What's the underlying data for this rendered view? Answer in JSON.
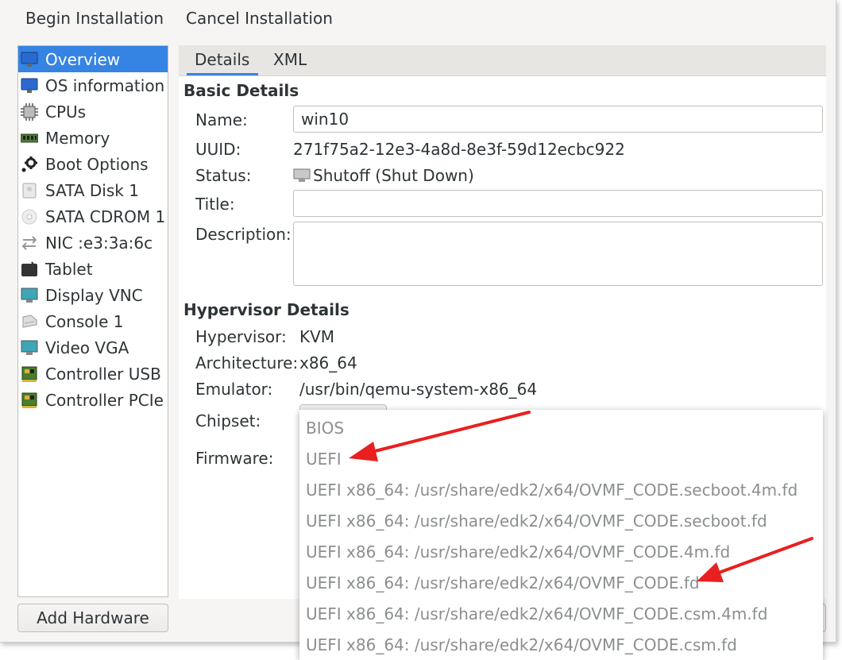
{
  "toolbar": {
    "begin_label": "Begin Installation",
    "cancel_label": "Cancel Installation"
  },
  "sidebar": {
    "items": [
      {
        "label": "Overview",
        "icon": "monitor-icon",
        "selected": true
      },
      {
        "label": "OS information",
        "icon": "monitor-icon"
      },
      {
        "label": "CPUs",
        "icon": "cpu-icon"
      },
      {
        "label": "Memory",
        "icon": "memory-icon"
      },
      {
        "label": "Boot Options",
        "icon": "gear-icon"
      },
      {
        "label": "SATA Disk 1",
        "icon": "disk-icon"
      },
      {
        "label": "SATA CDROM 1",
        "icon": "cdrom-icon"
      },
      {
        "label": "NIC :e3:3a:6c",
        "icon": "network-icon"
      },
      {
        "label": "Tablet",
        "icon": "tablet-icon"
      },
      {
        "label": "Display VNC",
        "icon": "display-icon"
      },
      {
        "label": "Console 1",
        "icon": "console-icon"
      },
      {
        "label": "Video VGA",
        "icon": "display-icon"
      },
      {
        "label": "Controller USB",
        "icon": "controller-icon"
      },
      {
        "label": "Controller PCIe",
        "icon": "controller-icon"
      }
    ],
    "add_hardware_label": "Add Hardware"
  },
  "tabs": [
    {
      "label": "Details",
      "active": true
    },
    {
      "label": "XML"
    }
  ],
  "basic": {
    "title": "Basic Details",
    "name_label": "Name:",
    "name_value": "win10",
    "uuid_label": "UUID:",
    "uuid_value": "271f75a2-12e3-4a8d-8e3f-59d12ecbc922",
    "status_label": "Status:",
    "status_value": "Shutoff (Shut Down)",
    "title_label": "Title:",
    "title_value": "",
    "description_label": "Description:",
    "description_value": ""
  },
  "hypervisor": {
    "title": "Hypervisor Details",
    "hypervisor_label": "Hypervisor:",
    "hypervisor_value": "KVM",
    "arch_label": "Architecture:",
    "arch_value": "x86_64",
    "emulator_label": "Emulator:",
    "emulator_value": "/usr/bin/qemu-system-x86_64",
    "chipset_label": "Chipset:",
    "firmware_label": "Firmware:"
  },
  "firmware_dropdown": {
    "options": [
      "BIOS",
      "UEFI",
      "UEFI x86_64: /usr/share/edk2/x64/OVMF_CODE.secboot.4m.fd",
      "UEFI x86_64: /usr/share/edk2/x64/OVMF_CODE.secboot.fd",
      "UEFI x86_64: /usr/share/edk2/x64/OVMF_CODE.4m.fd",
      "UEFI x86_64: /usr/share/edk2/x64/OVMF_CODE.fd",
      "UEFI x86_64: /usr/share/edk2/x64/OVMF_CODE.csm.4m.fd",
      "UEFI x86_64: /usr/share/edk2/x64/OVMF_CODE.csm.fd"
    ]
  },
  "colors": {
    "accent": "#3584e4",
    "annotation_arrow": "#e8201f",
    "disabled_text": "#8b8e8f"
  }
}
